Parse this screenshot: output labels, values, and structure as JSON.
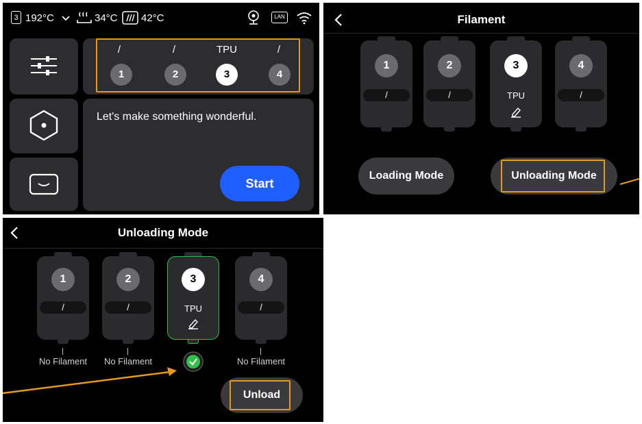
{
  "panel1": {
    "status": {
      "nozzle_index": "3",
      "nozzle_temp": "192°C",
      "bed_temp": "34°C",
      "chamber_temp": "42°C",
      "lan_label": "LAN",
      "icons": [
        "nozzle-icon",
        "chevron-down-icon",
        "heatbed-icon",
        "chamber-icon",
        "camera-icon",
        "lan-icon",
        "wifi-icon"
      ]
    },
    "slots": [
      {
        "label": "/",
        "number": "1",
        "active": false
      },
      {
        "label": "/",
        "number": "2",
        "active": false
      },
      {
        "label": "TPU",
        "number": "3",
        "active": true
      },
      {
        "label": "/",
        "number": "4",
        "active": false
      }
    ],
    "message": "Let's make something wonderful.",
    "start_label": "Start",
    "side_icons": [
      "settings-sliders-icon",
      "nozzle-hex-icon",
      "tray-icon"
    ],
    "highlight_color": "#e59a1e",
    "accent_color": "#1f5eff"
  },
  "panel2": {
    "title": "Filament",
    "spools": [
      {
        "number": "1",
        "material": "/",
        "active": false
      },
      {
        "number": "2",
        "material": "/",
        "active": false
      },
      {
        "number": "3",
        "material": "TPU",
        "active": true,
        "editable": true
      },
      {
        "number": "4",
        "material": "/",
        "active": false
      }
    ],
    "loading_label": "Loading Mode",
    "unloading_label": "Unloading Mode"
  },
  "panel3": {
    "title": "Unloading Mode",
    "spools": [
      {
        "number": "1",
        "material": "/",
        "status": "No Filament"
      },
      {
        "number": "2",
        "material": "/",
        "status": "No Filament"
      },
      {
        "number": "3",
        "material": "TPU",
        "status": "",
        "selected": true
      },
      {
        "number": "4",
        "material": "/",
        "status": "No Filament"
      }
    ],
    "unload_label": "Unload",
    "selected_color": "#2fbf4a"
  }
}
